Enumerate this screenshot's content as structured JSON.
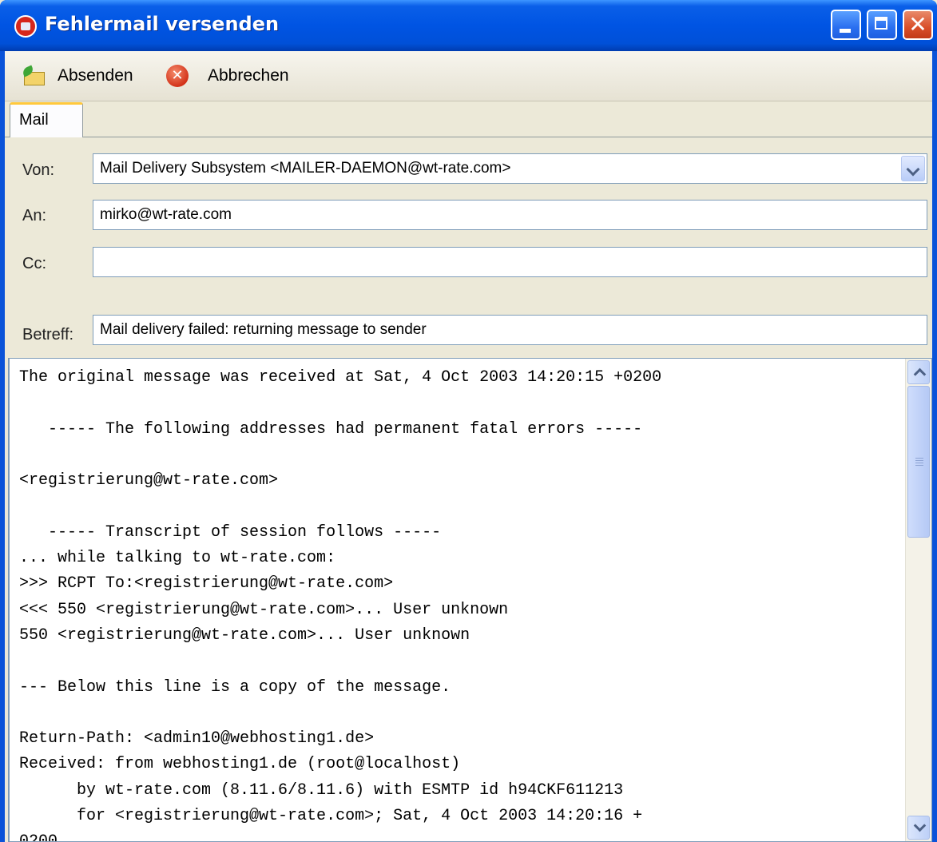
{
  "window": {
    "title": "Fehlermail versenden"
  },
  "toolbar": {
    "send_label": "Absenden",
    "cancel_label": "Abbrechen"
  },
  "tabs": [
    {
      "label": "Mail",
      "active": true
    }
  ],
  "form": {
    "from_label": "Von:",
    "from_value": "Mail Delivery Subsystem <MAILER-DAEMON@wt-rate.com>",
    "to_label": "An:",
    "to_value": "mirko@wt-rate.com",
    "cc_label": "Cc:",
    "cc_value": "",
    "subject_label": "Betreff:",
    "subject_value": "Mail delivery failed: returning message to sender"
  },
  "body": {
    "text": "The original message was received at Sat, 4 Oct 2003 14:20:15 +0200\n\n   ----- The following addresses had permanent fatal errors -----\n\n<registrierung@wt-rate.com>\n\n   ----- Transcript of session follows -----\n... while talking to wt-rate.com:\n>>> RCPT To:<registrierung@wt-rate.com>\n<<< 550 <registrierung@wt-rate.com>... User unknown\n550 <registrierung@wt-rate.com>... User unknown\n\n--- Below this line is a copy of the message.\n\nReturn-Path: <admin10@webhosting1.de>\nReceived: from webhosting1.de (root@localhost)\n      by wt-rate.com (8.11.6/8.11.6) with ESMTP id h94CKF611213\n      for <registrierung@wt-rate.com>; Sat, 4 Oct 2003 14:20:16 +\n0200"
  },
  "icons": {
    "app": "mail-error-icon",
    "send": "send-mail-icon",
    "cancel": "cancel-icon"
  },
  "colors": {
    "titlebar": "#0054e3",
    "tab_accent": "#ffc83c",
    "field_border": "#7f9db9",
    "close_button": "#d94f2a"
  }
}
